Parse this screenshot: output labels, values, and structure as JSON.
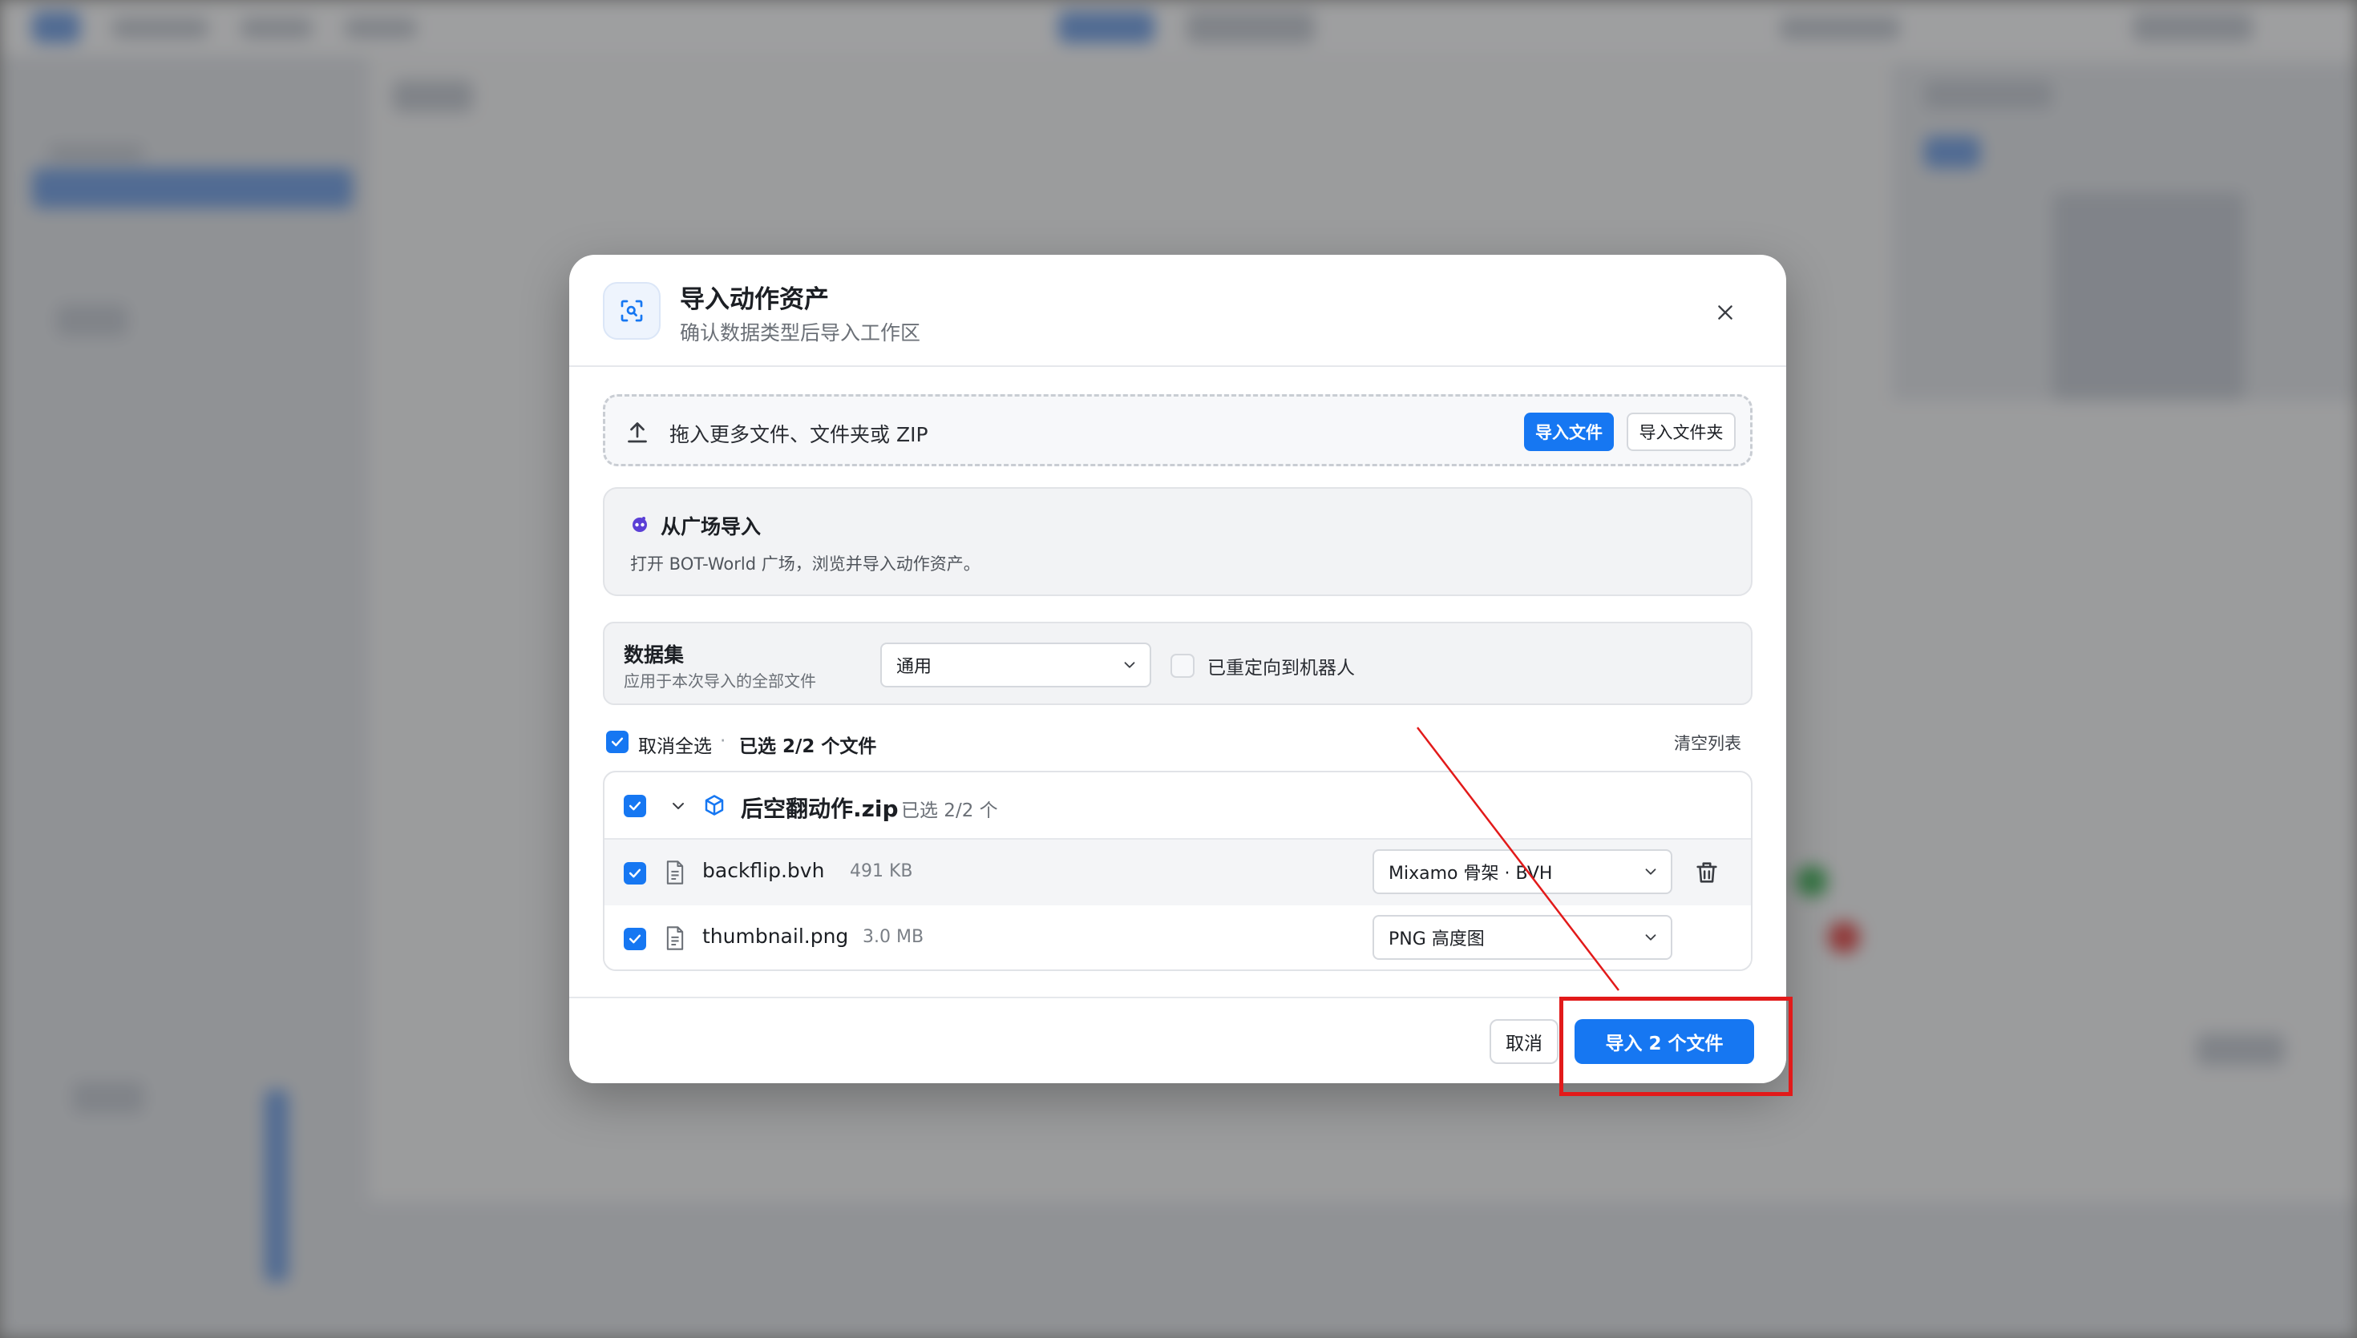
{
  "dialog": {
    "title": "导入动作资产",
    "subtitle": "确认数据类型后导入工作区",
    "icon": "scan-icon",
    "close_icon": "close-icon"
  },
  "dropzone": {
    "text": "拖入更多文件、文件夹或 ZIP",
    "icon": "upload-icon",
    "import_file_label": "导入文件",
    "import_folder_label": "导入文件夹"
  },
  "plaza": {
    "title": "从广场导入",
    "description": "打开 BOT-World 广场，浏览并导入动作资产。",
    "icon": "bot-world-icon"
  },
  "dataset": {
    "title": "数据集",
    "description": "应用于本次导入的全部文件",
    "selected": "通用",
    "redirect_label": "已重定向到机器人",
    "redirect_checked": false
  },
  "selection": {
    "select_all_label": "取消全选",
    "separator": "·",
    "count_label": "已选 2/2 个文件",
    "clear_label": "清空列表"
  },
  "group": {
    "name": "后空翻动作.zip",
    "count": "已选 2/2 个",
    "expanded": true,
    "checked": true
  },
  "files": [
    {
      "name": "backflip.bvh",
      "size": "491 KB",
      "type": "Mixamo 骨架 · BVH",
      "checked": true
    },
    {
      "name": "thumbnail.png",
      "size": "3.0 MB",
      "type": "PNG 高度图",
      "checked": true
    }
  ],
  "footer": {
    "cancel_label": "取消",
    "import_label": "导入 2 个文件"
  },
  "colors": {
    "primary": "#1677f2",
    "annotation": "#e21a1a",
    "plaza_icon": "#5b3fd6"
  }
}
